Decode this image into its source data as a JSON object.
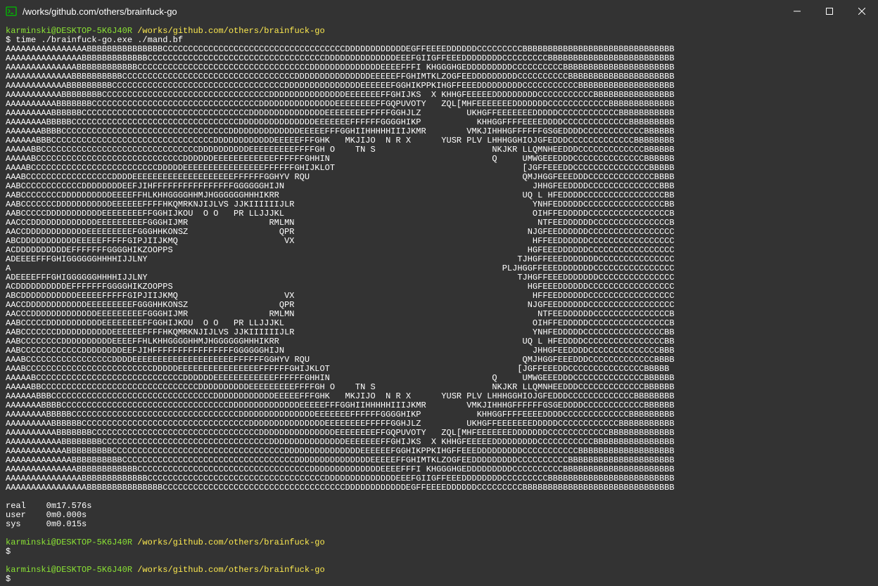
{
  "window": {
    "title": "/works/github.com/others/brainfuck-go"
  },
  "prompt": {
    "user_host": "karminski@DESKTOP-5K6J40R",
    "cwd": "/works/github.com/others/brainfuck-go",
    "symbol": "$"
  },
  "command": "time ./brainfuck-go.exe ./mand.bf",
  "output_lines": [
    "AAAAAAAAAAAAAAAABBBBBBBBBBBBBBBCCCCCCCCCCCCCCCCCCCCCCCCCCCCCCCCCCCCDDDDDDDDDDDDEGFFEEEEDDDDDDCCCCCCCCCBBBBBBBBBBBBBBBBBBBBBBBBBBBBBB",
    "AAAAAAAAAAAAAAABBBBBBBBBBBBBCCCCCCCCCCCCCCCCCCCCCCCCCCCCCCCCCCCDDDDDDDDDDDDDDEEEFGIIGFFEEEDDDDDDDDCCCCCCCCCBBBBBBBBBBBBBBBBBBBBBBBBB",
    "AAAAAAAAAAAAAABBBBBBBBBBBBCCCCCCCCCCCCCCCCCCCCCCCCCCCCCCCCCCDDDDDDDDDDDDDDEEEEFFFI KHGGGHGEDDDDDDDDDCCCCCCCCCCBBBBBBBBBBBBBBBBBBBBBB",
    "AAAAAAAAAAAAABBBBBBBBBBCCCCCCCCCCCCCCCCCCCCCCCCCCCCCCCCCCDDDDDDDDDDDDDDDEEEEEFFGHIMTKLZOGFEEDDDDDDDDDCCCCCCCCCCBBBBBBBBBBBBBBBBBBBBB",
    "AAAAAAAAAAAABBBBBBBBBCCCCCCCCCCCCCCCCCCCCCCCCCCCCCCCCCCDDDDDDDDDDDDDDDEEEEEEFGGHIKPPKIHGFFEEEDDDDDDDDDCCCCCCCCCCCBBBBBBBBBBBBBBBBBBB",
    "AAAAAAAAAAABBBBBBBBCCCCCCCCCCCCCCCCCCCCCCCCCCCCCCCCCDDDDDDDDDDDDDDDEEEEEEEFFGHIJKS  X KHHGFEEEEEDDDDDDDDDCCCCCCCCCCCBBBBBBBBBBBBBBBB",
    "AAAAAAAAAABBBBBBBCCCCCCCCCCCCCCCCCCCCCCCCCCCCCCCCCDDDDDDDDDDDDDDDEEEEEEEEFFGQPUVOTY   ZQL[MHFEEEEEEEDDDDDDDCCCCCCCCCCCCBBBBBBBBBBBBB",
    "AAAAAAAAABBBBBBCCCCCCCCCCCCCCCCCCCCCCCCCCCCCCCCCDDDDDDDDDDDDDDDEEEEEEEEFFFFFGGHJLZ         UKHGFFEEEEEEEDDDDDCCCCCCCCCCCCBBBBBBBBBBB",
    "AAAAAAAABBBBBCCCCCCCCCCCCCCCCCCCCCCCCCCCCCCCCCDDDDDDDDDDDDDDDEEEEEEEFFFFFFGGGGHIKP           KHHGGFFFFEEEEDDDDCCCCCCCCCCCCCBBBBBBBBB",
    "AAAAAAABBBBCCCCCCCCCCCCCCCCCCCCCCCCCCCCCCCCCDDDDDDDDDDDDDDEEEEEFFFGGHIIHHHHHIIIJKMR        VMKJIHHHGFFFFFFGSGEDDDDCCCCCCCCCCCCBBBBBB",
    "AAAAAABBBCCCCCCCCCCCCCCCCCCCCCCCCCCCCCCCCDDDDDDDDDDDDEEEEEFFFGHK   MKJIJO  N R X      YUSR PLV LHHHGGHIOJGFEDDDCCCCCCCCCCCCCBBBBBBBB",
    "AAAAABBCCCCCCCCCCCCCCCCCCCCCCCCCCCCCCCDDDDDDDDDDEEEEEEEEEFFFFGH O    TN S                       NKJKR LLQMNHEEDDDCCCCCCCCCCCCCBBBBBB",
    "AAAAABCCCCCCCCCCCCCCCCCCCCCCCCCCCCCDDDDDDEEEEEEEEEEEEFFFFFFGHHIN                                Q     UMWGEEEDDDCCCCCCCCCCCCCCBBBBBB",
    "AAAABCCCCCCCCCCCCCCCCCCCCCCCCCDDDDDEEEEEEEEEEEEEEEEFFFFFFGHIJKLOT                                     [JGFFEEEDDCCCCCCCCCCCCCCCBBBBB",
    "AAABCCCCCCCCCCCCCCCCCDDDDEEEEEEEEEEEEEEEEEEEEFFFFFFGGHYV RQU                                          QMJHGGFEEEDDDCCCCCCCCCCCCCBBBB",
    "AABCCCCCCCCCCCCDDDDDDDDEEFJIHFFFFFFFFFFFFFFFFGGGGGGHIJN                                                 JHHGFEEDDDDCCCCCCCCCCCCCCBBB",
    "AABCCCCCCCCDDDDDDDDDDEEEEFFHLKHHGGGGHHMJHGGGGGGHHHIKRR                                                UQ L HFEDDDDCCCCCCCCCCCCCCCCBB",
    "AABCCCCCCCDDDDDDDDDDDEEEEEEFFFFHKQMRKNJIJLVS JJKIIIIIIJLR                                               YNHFEDDDDDCCCCCCCCCCCCCCCCBB",
    "AABCCCCCDDDDDDDDDDDEEEEEEEEFFGGHIJKOU  O O   PR LLJJJKL                                                 OIHFFEDDDDDCCCCCCCCCCCCCCCCB",
    "AACCCDDDDDDDDDDDDDEEEEEEEEEFGGGHIJMR                RMLMN                                                NTFEEDDDDDDCCCCCCCCCCCCCCCB",
    "AACCDDDDDDDDDDDDEEEEEEEEEFGGGHHKONSZ                  QPR                                              NJGFEEDDDDDDCCCCCCCCCCCCCCCCC",
    "ABCDDDDDDDDDDDEEEEEFFFFFGIPJIIJKMQ                     VX                                               HFFEEDDDDDDCCCCCCCCCCCCCCCCC",
    "ACDDDDDDDDDDEFFFFFFFGGGGHIKZOOPPS                                                                      HGFEEEDDDDDDCCCCCCCCCCCCCCCCC",
    "ADEEEEFFFGHIGGGGGGHHHHIJJLNY                                                                         TJHGFFEEEDDDDDDDCCCCCCCCCCCCCCC",
    "A                                                                                                 PLJHGGFFEEEDDDDDDDCCCCCCCCCCCCCCCC",
    "ADEEEEFFFGHIGGGGGGHHHHIJJLNY                                                                         TJHGFFEEEDDDDDDDCCCCCCCCCCCCCCC",
    "ACDDDDDDDDDDEFFFFFFFGGGGHIKZOOPPS                                                                      HGFEEEDDDDDDCCCCCCCCCCCCCCCCC",
    "ABCDDDDDDDDDDDEEEEEFFFFFGIPJIIJKMQ                     VX                                               HFFEEDDDDDDCCCCCCCCCCCCCCCCC",
    "AACCDDDDDDDDDDDDEEEEEEEEEFGGGHHKONSZ                  QPR                                              NJGFEEDDDDDDCCCCCCCCCCCCCCCCC",
    "AACCCDDDDDDDDDDDDDEEEEEEEEEFGGGHIJMR                RMLMN                                                NTFEEDDDDDDCCCCCCCCCCCCCCCB",
    "AABCCCCCDDDDDDDDDDDEEEEEEEEFFGGHIJKOU  O O   PR LLJJJKL                                                 OIHFFEDDDDDCCCCCCCCCCCCCCCCB",
    "AABCCCCCCCDDDDDDDDDDDEEEEEEFFFFHKQMRKNJIJLVS JJKIIIIIIJLR                                               YNHFEDDDDDCCCCCCCCCCCCCCCCBB",
    "AABCCCCCCCCDDDDDDDDDDEEEEFFHLKHHGGGGHHMJHGGGGGGHHHIKRR                                                UQ L HFEDDDDCCCCCCCCCCCCCCCCBB",
    "AABCCCCCCCCCCCCDDDDDDDDEEFJIHFFFFFFFFFFFFFFFFGGGGGGHIJN                                                 JHHGFEEDDDDCCCCCCCCCCCCCCBBB",
    "AAABCCCCCCCCCCCCCCCCCDDDDEEEEEEEEEEEEEEEEEEEEFFFFFFGGHYV RQU                                          QMJHGGFEEEDDDCCCCCCCCCCCCCBBBB",
    "AAABCCCCCCCCCCCCCCCCCCCCCCCCCDDDDDEEEEEEEEEEEEEEEEFFFFFFGHIJKLOT                                     [JGFFEEEDDCCCCCCCCCCCCCCCBBBBB",
    "AAAAABCCCCCCCCCCCCCCCCCCCCCCCCCCCCCDDDDDDEEEEEEEEEEEEFFFFFFGHHIN                                Q     UMWGEEEDDDCCCCCCCCCCCCCCBBBBBB",
    "AAAAABBCCCCCCCCCCCCCCCCCCCCCCCCCCCCCCCDDDDDDDDDDEEEEEEEEEFFFFGH O    TN S                       NKJKR LLQMNHEEDDDCCCCCCCCCCCCCBBBBBB",
    "AAAAAABBBCCCCCCCCCCCCCCCCCCCCCCCCCCCCCCCCDDDDDDDDDDDDEEEEEFFFGHK   MKJIJO  N R X      YUSR PLV LHHHGGHIOJGFEDDDCCCCCCCCCCCCCBBBBBBBB",
    "AAAAAAABBBBCCCCCCCCCCCCCCCCCCCCCCCCCCCCCCCCCDDDDDDDDDDDDDDEEEEEFFFGGHIIHHHHHIIIJKMR        VMKJIHHHGFFFFFFGSGEDDDDCCCCCCCCCCCCBBBBBB",
    "AAAAAAAABBBBBCCCCCCCCCCCCCCCCCCCCCCCCCCCCCCCCCDDDDDDDDDDDDDDDEEEEEEEFFFFFFGGGGHIKP           KHHGGFFFFEEEEDDDDCCCCCCCCCCCCCBBBBBBBBB",
    "AAAAAAAAABBBBBBCCCCCCCCCCCCCCCCCCCCCCCCCCCCCCCCCDDDDDDDDDDDDDDDEEEEEEEEFFFFFGGHJLZ         UKHGFFEEEEEEEDDDDDCCCCCCCCCCCCBBBBBBBBBBB",
    "AAAAAAAAAABBBBBBBCCCCCCCCCCCCCCCCCCCCCCCCCCCCCCCCCDDDDDDDDDDDDDDDEEEEEEEEFFGQPUVOTY   ZQL[MHFEEEEEEEDDDDDDDCCCCCCCCCCCCBBBBBBBBBBBBB",
    "AAAAAAAAAAABBBBBBBBCCCCCCCCCCCCCCCCCCCCCCCCCCCCCCCCCDDDDDDDDDDDDDDDEEEEEEEFFGHIJKS  X KHHGFEEEEEDDDDDDDDDCCCCCCCCCCCBBBBBBBBBBBBBBBB",
    "AAAAAAAAAAAABBBBBBBBBCCCCCCCCCCCCCCCCCCCCCCCCCCCCCCCCCCDDDDDDDDDDDDDDDEEEEEEFGGHIKPPKIHGFFEEEDDDDDDDDDCCCCCCCCCCCBBBBBBBBBBBBBBBBBBB",
    "AAAAAAAAAAAAABBBBBBBBBBCCCCCCCCCCCCCCCCCCCCCCCCCCCCCCCCCCDDDDDDDDDDDDDDDEEEEEFFGHIMTKLZOGFEEDDDDDDDDDCCCCCCCCCCBBBBBBBBBBBBBBBBBBBBB",
    "AAAAAAAAAAAAAABBBBBBBBBBBBCCCCCCCCCCCCCCCCCCCCCCCCCCCCCCCCCCDDDDDDDDDDDDDDEEEEFFFI KHGGGHGEDDDDDDDDDCCCCCCCCCCBBBBBBBBBBBBBBBBBBBBBB",
    "AAAAAAAAAAAAAAABBBBBBBBBBBBBCCCCCCCCCCCCCCCCCCCCCCCCCCCCCCCCCCCDDDDDDDDDDDDDDEEEFGIIGFFEEEDDDDDDDDCCCCCCCCCBBBBBBBBBBBBBBBBBBBBBBBBB",
    "AAAAAAAAAAAAAAAABBBBBBBBBBBBBBBCCCCCCCCCCCCCCCCCCCCCCCCCCCCCCCCCCCCDDDDDDDDDDDDEGFFEEEEDDDDDDCCCCCCCCCBBBBBBBBBBBBBBBBBBBBBBBBBBBBBB"
  ],
  "timing": {
    "real_label": "real",
    "real_value": "0m17.576s",
    "user_label": "user",
    "user_value": "0m0.000s",
    "sys_label": "sys",
    "sys_value": "0m0.015s"
  }
}
